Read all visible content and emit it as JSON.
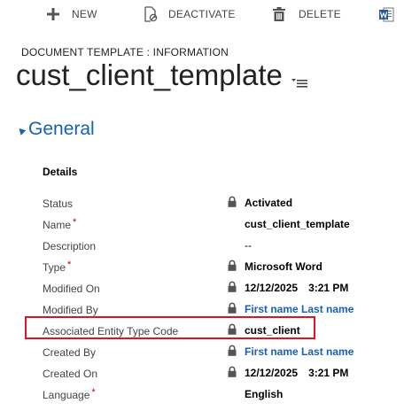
{
  "toolbar": {
    "new_label": "NEW",
    "deactivate_label": "DEACTIVATE",
    "delete_label": "DELETE"
  },
  "header": {
    "entity_label": "DOCUMENT TEMPLATE : INFORMATION",
    "title": "cust_client_template"
  },
  "section": {
    "title": "General",
    "subheading": "Details"
  },
  "fields": {
    "status": {
      "label": "Status",
      "value": "Activated"
    },
    "name": {
      "label": "Name",
      "value": "cust_client_template",
      "required": "*"
    },
    "description": {
      "label": "Description",
      "value": "--"
    },
    "type": {
      "label": "Type",
      "value": "Microsoft Word",
      "required": "*"
    },
    "modified_on": {
      "label": "Modified On",
      "date": "12/12/2025",
      "time": "3:21 PM"
    },
    "modified_by": {
      "label": "Modified By",
      "value": "First name Last name"
    },
    "associated_entity": {
      "label": "Associated Entity Type Code",
      "value": "cust_client"
    },
    "created_by": {
      "label": "Created By",
      "value": "First name Last name"
    },
    "created_on": {
      "label": "Created On",
      "date": "12/12/2025",
      "time": "3:21 PM"
    },
    "language": {
      "label": "Language",
      "value": "English",
      "required": "*"
    }
  },
  "colors": {
    "accent": "#1560bd",
    "required": "#c00000",
    "highlight": "#e0141e",
    "word": "#2b579a"
  }
}
